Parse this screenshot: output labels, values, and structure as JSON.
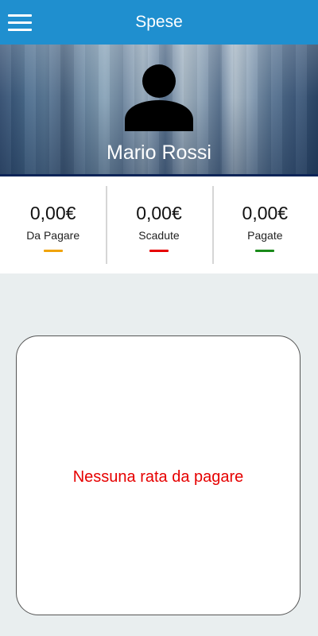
{
  "topbar": {
    "title": "Spese",
    "menu_icon": "hamburger-menu-icon",
    "background": "#1f8fcf"
  },
  "profile": {
    "name": "Mario Rossi",
    "avatar_icon": "person-icon"
  },
  "stats": [
    {
      "amount": "0,00€",
      "label": "Da Pagare",
      "color": "#f0a30a"
    },
    {
      "amount": "0,00€",
      "label": "Scadute",
      "color": "#e60000"
    },
    {
      "amount": "0,00€",
      "label": "Pagate",
      "color": "#1a8a1a"
    }
  ],
  "card": {
    "message": "Nessuna rata da pagare",
    "message_color": "#e60000"
  }
}
